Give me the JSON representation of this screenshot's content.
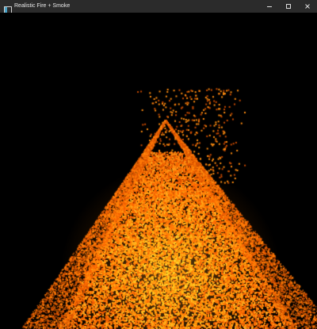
{
  "window": {
    "title": "Realistic Fire + Smoke",
    "app_icon": "window-app-icon",
    "controls": {
      "minimize_icon": "minimize-icon",
      "maximize_icon": "maximize-icon",
      "close_icon": "close-icon"
    }
  },
  "scene": {
    "background": "#000000",
    "fire_colors": [
      "#ff6a00",
      "#ff8c10",
      "#ffa020",
      "#e85a00",
      "#ff7a08",
      "#c84a00"
    ]
  }
}
